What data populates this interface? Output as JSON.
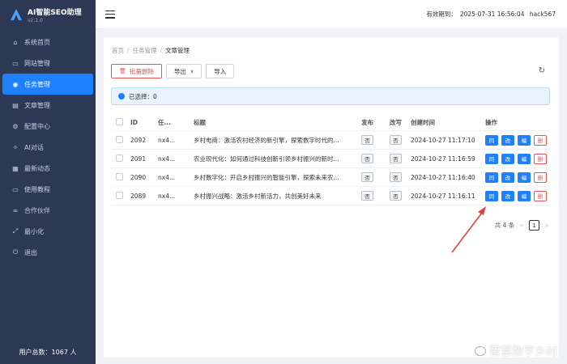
{
  "sidebar": {
    "brand_title": "AI智能SEO助理",
    "brand_version": "v2.1.0",
    "items": [
      {
        "label": "系统首页",
        "icon": "home-icon",
        "glyph": "⌂"
      },
      {
        "label": "网站管理",
        "icon": "website-icon",
        "glyph": "▭"
      },
      {
        "label": "任务管理",
        "icon": "task-icon",
        "glyph": "◉"
      },
      {
        "label": "文章管理",
        "icon": "article-icon",
        "glyph": "▤"
      },
      {
        "label": "配置中心",
        "icon": "settings-icon",
        "glyph": "⚙"
      },
      {
        "label": "AI对话",
        "icon": "ai-chat-icon",
        "glyph": "✧"
      },
      {
        "label": "最新动态",
        "icon": "news-icon",
        "glyph": "▦"
      },
      {
        "label": "使用教程",
        "icon": "tutorial-icon",
        "glyph": "▭"
      },
      {
        "label": "合作伙伴",
        "icon": "partner-icon",
        "glyph": "∞"
      },
      {
        "label": "最小化",
        "icon": "minimize-icon",
        "glyph": "⤢"
      },
      {
        "label": "退出",
        "icon": "logout-icon",
        "glyph": "⏻"
      }
    ],
    "active_index": 2,
    "user_count": "用户总数：1067 人"
  },
  "header": {
    "expire_label": "有效期到：",
    "expire_value": "2025-07-31 16:56:04",
    "username": "hack567"
  },
  "breadcrumb": {
    "home": "首页",
    "parent": "任务管理",
    "current": "文章管理"
  },
  "toolbar": {
    "batch_delete": "批量删除",
    "export": "导出",
    "import": "导入"
  },
  "selection": {
    "label": "已选择：0"
  },
  "table": {
    "headers": {
      "id": "ID",
      "task": "任...",
      "title": "标题",
      "publish": "发布",
      "rewrite": "改写",
      "created": "创建时间",
      "ops": "操作"
    },
    "rows": [
      {
        "id": "2092",
        "task": "nx4...",
        "title": "乡村电商：激活农村经济的新引擎，探索数字时代的...",
        "publish": "否",
        "rewrite": "否",
        "created": "2024-10-27 11:17:10"
      },
      {
        "id": "2091",
        "task": "nx4...",
        "title": "农业现代化：如何通过科技创新引领乡村振兴的新时...",
        "publish": "否",
        "rewrite": "否",
        "created": "2024-10-27 11:16:59"
      },
      {
        "id": "2090",
        "task": "nx4...",
        "title": "乡村数字化：开启乡村振兴的智能引擎，探索未来农...",
        "publish": "否",
        "rewrite": "否",
        "created": "2024-10-27 11:16:40"
      },
      {
        "id": "2089",
        "task": "nx4...",
        "title": "乡村振兴战略：激活乡村新活力，共创美好未来",
        "publish": "否",
        "rewrite": "否",
        "created": "2024-10-27 11:16:11"
      }
    ],
    "op_labels": {
      "publish": "同",
      "rewrite": "改",
      "edit": "编",
      "delete": "删"
    }
  },
  "pagination": {
    "total": "共 4 条",
    "prev": "<",
    "page": "1",
    "next": ">"
  },
  "watermark": "智慧数字乡村",
  "colors": {
    "sidebar_bg": "#2c3854",
    "accent": "#1e80ff",
    "danger": "#e65454",
    "annotation_arrow": "#d9463e"
  }
}
